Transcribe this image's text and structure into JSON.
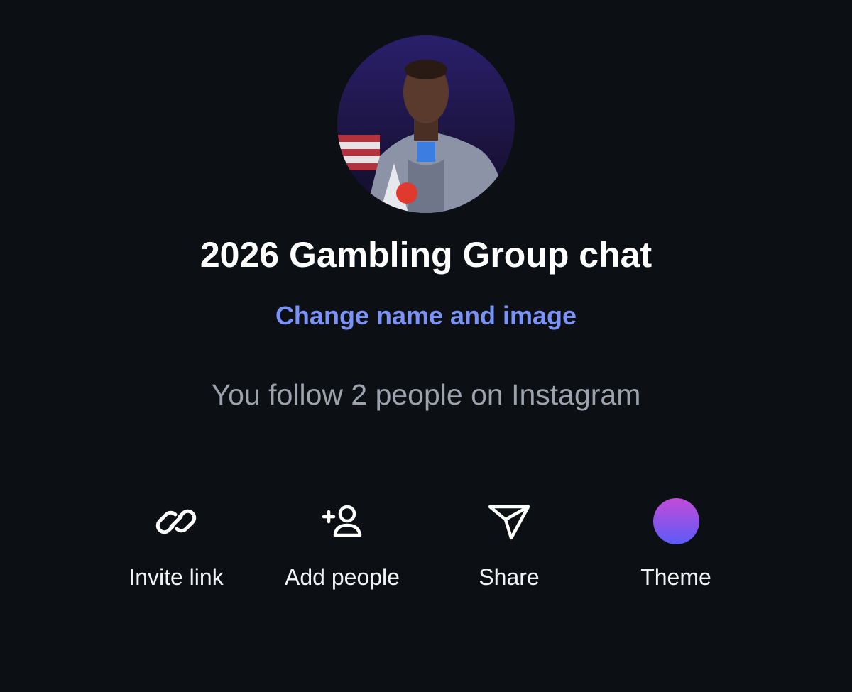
{
  "group": {
    "name": "2026 Gambling Group chat",
    "change_label": "Change name and image",
    "follow_text": "You follow 2 people on Instagram"
  },
  "actions": [
    {
      "label": "Invite link",
      "icon": "link-icon"
    },
    {
      "label": "Add people",
      "icon": "add-person-icon"
    },
    {
      "label": "Share",
      "icon": "send-icon"
    },
    {
      "label": "Theme",
      "icon": "theme-swatch"
    }
  ],
  "colors": {
    "background": "#0c0f14",
    "link": "#7b93f7",
    "muted_text": "#9da3ad",
    "theme_gradient_top": "#c34bd9",
    "theme_gradient_bottom": "#5b5cf6"
  }
}
